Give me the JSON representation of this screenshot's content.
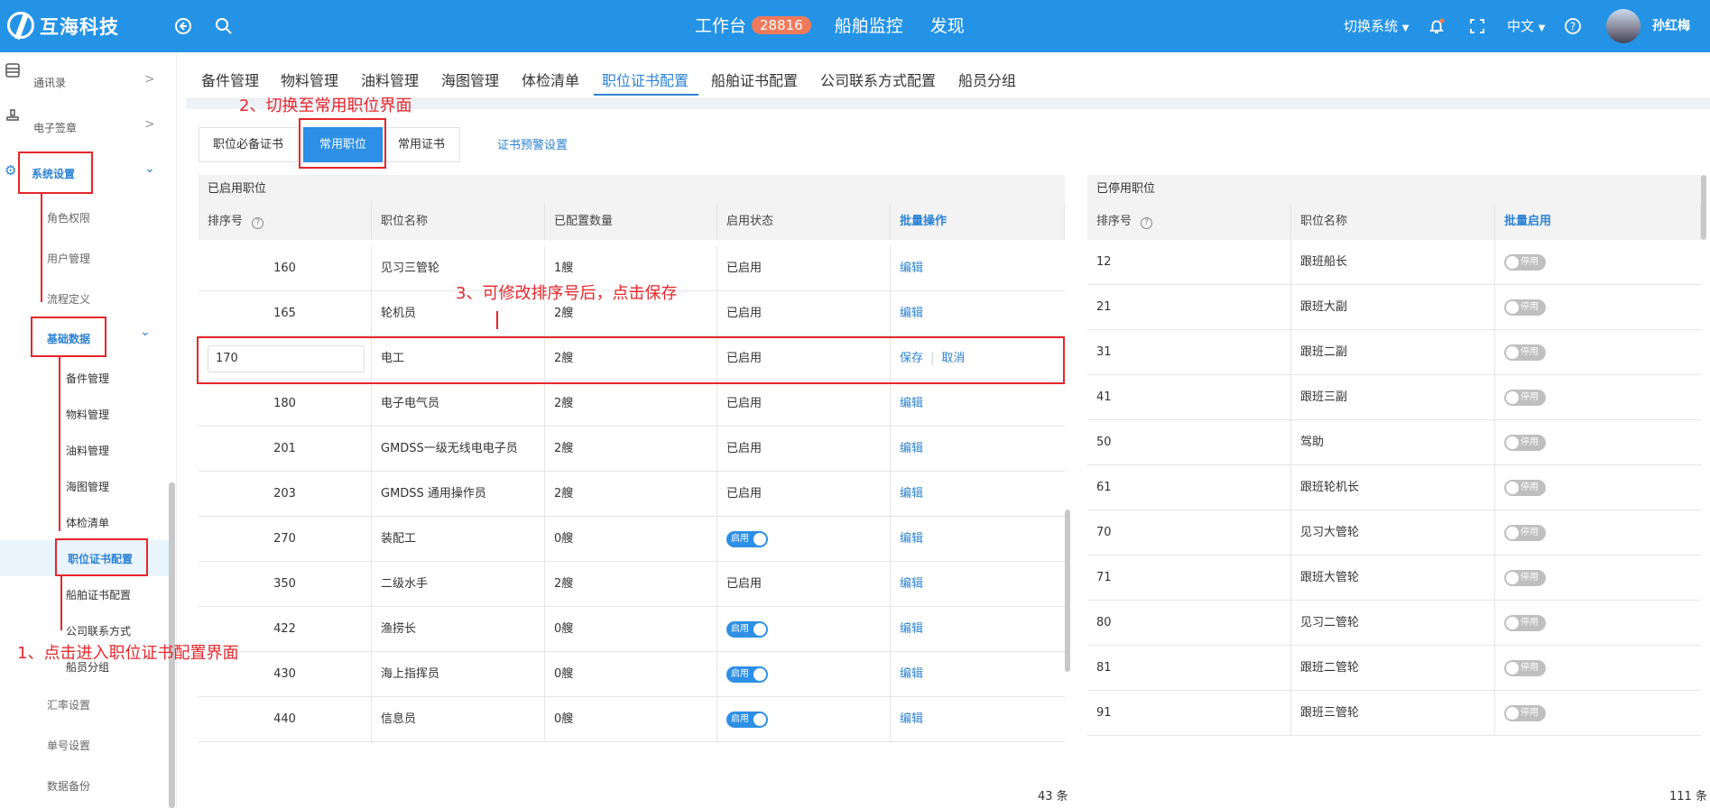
{
  "header": {
    "brand": "互海科技",
    "workbench": "工作台",
    "workbench_count": "28816",
    "ship_monitor": "船舶监控",
    "discover": "发现",
    "switch_system": "切换系统",
    "language": "中文",
    "user_name": "孙红梅"
  },
  "sidebar": {
    "contacts": "通讯录",
    "esign": "电子签章",
    "system_settings": "系统设置",
    "roles": "角色权限",
    "users": "用户管理",
    "workflow": "流程定义",
    "basic_data": "基础数据",
    "spare_parts": "备件管理",
    "materials": "物料管理",
    "fuel": "油料管理",
    "charts": "海图管理",
    "medical": "体检清单",
    "position_cert": "职位证书配置",
    "ship_cert": "船舶证书配置",
    "company_contact": "公司联系方式",
    "crew_group": "船员分组",
    "exchange_rate": "汇率设置",
    "number_setting": "单号设置",
    "data_backup": "数据备份"
  },
  "topnav": {
    "items": [
      "备件管理",
      "物料管理",
      "油料管理",
      "海图管理",
      "体检清单",
      "职位证书配置",
      "船舶证书配置",
      "公司联系方式配置",
      "船员分组"
    ]
  },
  "subtabs": {
    "required_cert": "职位必备证书",
    "common_position": "常用职位",
    "common_cert": "常用证书",
    "cert_warning": "证书预警设置"
  },
  "enabled_table": {
    "title": "已启用职位",
    "headers": {
      "sort": "排序号",
      "name": "职位名称",
      "count": "已配置数量",
      "status": "启用状态",
      "batch": "批量操作"
    },
    "edit_label": "编辑",
    "save_label": "保存",
    "cancel_label": "取消",
    "toggle_on_label": "启用",
    "editing_value": "170",
    "rows": [
      {
        "sort": "160",
        "name": "见习三管轮",
        "count": "1艘",
        "status": "已启用"
      },
      {
        "sort": "165",
        "name": "轮机员",
        "count": "2艘",
        "status": "已启用"
      },
      {
        "sort": "170",
        "name": "电工",
        "count": "2艘",
        "status": "已启用"
      },
      {
        "sort": "180",
        "name": "电子电气员",
        "count": "2艘",
        "status": "已启用"
      },
      {
        "sort": "201",
        "name": "GMDSS一级无线电电子员",
        "count": "2艘",
        "status": "已启用"
      },
      {
        "sort": "203",
        "name": "GMDSS 通用操作员",
        "count": "2艘",
        "status": "已启用"
      },
      {
        "sort": "270",
        "name": "装配工",
        "count": "0艘",
        "status": "toggle"
      },
      {
        "sort": "350",
        "name": "二级水手",
        "count": "2艘",
        "status": "已启用"
      },
      {
        "sort": "422",
        "name": "渔捞长",
        "count": "0艘",
        "status": "toggle"
      },
      {
        "sort": "430",
        "name": "海上指挥员",
        "count": "0艘",
        "status": "toggle"
      },
      {
        "sort": "440",
        "name": "信息员",
        "count": "0艘",
        "status": "toggle"
      }
    ],
    "total": "43 条"
  },
  "disabled_table": {
    "title": "已停用职位",
    "headers": {
      "sort": "排序号",
      "name": "职位名称",
      "batch": "批量启用"
    },
    "toggle_off_label": "停用",
    "rows": [
      {
        "sort": "12",
        "name": "跟班船长"
      },
      {
        "sort": "21",
        "name": "跟班大副"
      },
      {
        "sort": "31",
        "name": "跟班二副"
      },
      {
        "sort": "41",
        "name": "跟班三副"
      },
      {
        "sort": "50",
        "name": "驾助"
      },
      {
        "sort": "61",
        "name": "跟班轮机长"
      },
      {
        "sort": "70",
        "name": "见习大管轮"
      },
      {
        "sort": "71",
        "name": "跟班大管轮"
      },
      {
        "sort": "80",
        "name": "见习二管轮"
      },
      {
        "sort": "81",
        "name": "跟班二管轮"
      },
      {
        "sort": "91",
        "name": "跟班三管轮"
      }
    ],
    "total": "111 条"
  },
  "annotations": {
    "step1": "1、点击进入职位证书配置界面",
    "step2": "2、切换至常用职位界面",
    "step3": "3、可修改排序号后，点击保存"
  }
}
